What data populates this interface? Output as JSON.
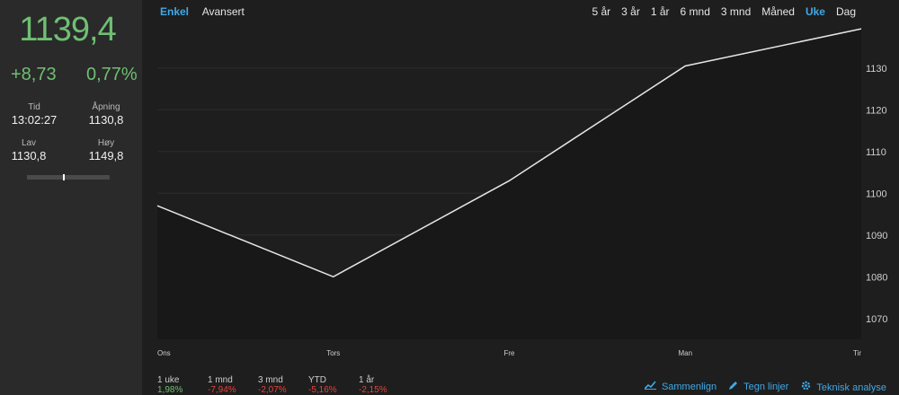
{
  "quote": {
    "price": "1139,4",
    "change_abs": "+8,73",
    "change_pct": "0,77%",
    "time_label": "Tid",
    "time_value": "13:02:27",
    "open_label": "Åpning",
    "open_value": "1130,8",
    "low_label": "Lav",
    "low_value": "1130,8",
    "high_label": "Høy",
    "high_value": "1149,8",
    "range_position": 0.45
  },
  "modes": {
    "simple": "Enkel",
    "advanced": "Avansert",
    "active": "simple"
  },
  "periods": [
    "5 år",
    "3 år",
    "1 år",
    "6 mnd",
    "3 mnd",
    "Måned",
    "Uke",
    "Dag"
  ],
  "active_period": "Uke",
  "chart_data": {
    "type": "line",
    "x": [
      "Ons",
      "Tors",
      "Fre",
      "Man",
      "Tir"
    ],
    "series": [
      {
        "values": [
          1097,
          1080,
          1103,
          1130.5,
          1139.4
        ]
      }
    ],
    "yticks": [
      1070,
      1080,
      1090,
      1100,
      1110,
      1120,
      1130
    ],
    "ylim": [
      1065,
      1142
    ],
    "grid": true,
    "line_color": "#e6e6e6"
  },
  "performance": [
    {
      "label": "1 uke",
      "value": "1,98%",
      "sign": "pos"
    },
    {
      "label": "1 mnd",
      "value": "-7,94%",
      "sign": "neg"
    },
    {
      "label": "3 mnd",
      "value": "-2,07%",
      "sign": "neg"
    },
    {
      "label": "YTD",
      "value": "-5,16%",
      "sign": "neg"
    },
    {
      "label": "1 år",
      "value": "-2,15%",
      "sign": "neg"
    }
  ],
  "tools": {
    "compare": "Sammenlign",
    "draw": "Tegn linjer",
    "technical": "Teknisk analyse",
    "compare_icon": "line-chart-icon",
    "draw_icon": "pencil-icon",
    "technical_icon": "gear-icon"
  },
  "colors": {
    "positive": "#6fbf73",
    "negative": "#e5433a",
    "accent": "#3fa9e8"
  }
}
